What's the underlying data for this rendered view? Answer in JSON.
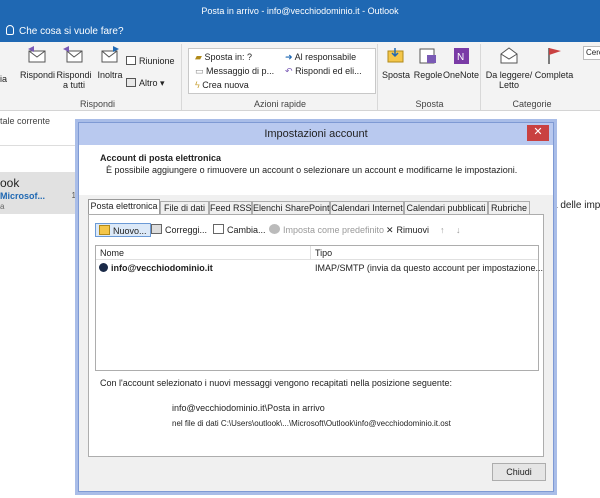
{
  "window": {
    "title": "Posta in arrivo - info@vecchiodominio.it - Outlook"
  },
  "tell_me": {
    "placeholder": "Che cosa si vuole fare?"
  },
  "ribbon": {
    "respond": {
      "label": "Rispondi",
      "reply": "Rispondi",
      "reply_all_line1": "Rispondi",
      "reply_all_line2": "a tutti",
      "forward": "Inoltra",
      "meeting": "Riunione",
      "more": "Altro",
      "left_cut": "ia"
    },
    "quick_steps": {
      "label": "Azioni rapide",
      "items": [
        "Sposta in: ?",
        "Messaggio di p...",
        "Crea nuova",
        "Al responsabile",
        "Rispondi ed eli..."
      ]
    },
    "move": {
      "label": "Sposta",
      "move": "Sposta",
      "rules": "Regole",
      "onenote": "OneNote"
    },
    "tags": {
      "label": "Categorie",
      "unread_line1": "Da leggere/",
      "unread_line2": "Letto",
      "complete": "Completa"
    },
    "search": {
      "placeholder": "Cerc"
    }
  },
  "left_pane": {
    "mailbox_scope": "tale corrente",
    "account_title": "ook",
    "account_sub": "Microsof...",
    "account_sub2": "a",
    "count": "1"
  },
  "right_snip": "a delle imp",
  "dialog": {
    "title": "Impostazioni account",
    "close_glyph": "✕",
    "heading": "Account di posta elettronica",
    "description": "È possibile aggiungere o rimuovere un account o selezionare un account e modificarne le impostazioni.",
    "tabs": [
      "Posta elettronica",
      "File di dati",
      "Feed RSS",
      "Elenchi SharePoint",
      "Calendari Internet",
      "Calendari pubblicati",
      "Rubriche"
    ],
    "toolbar": {
      "new": "Nuovo...",
      "repair": "Correggi...",
      "change": "Cambia...",
      "set_default": "Imposta come predefinito",
      "remove": "Rimuovi",
      "up": "↑",
      "down": "↓"
    },
    "columns": {
      "name": "Nome",
      "type": "Tipo"
    },
    "accounts": [
      {
        "name": "info@vecchiodominio.it",
        "type": "IMAP/SMTP (invia da questo account per impostazione..."
      }
    ],
    "delivery_text": "Con l'account selezionato i nuovi messaggi vengono recapitati nella posizione seguente:",
    "delivery_path": "info@vecchiodominio.it\\Posta in arrivo",
    "delivery_file": "nel file di dati C:\\Users\\outlook\\...\\Microsoft\\Outlook\\info@vecchiodominio.it.ost",
    "close_button": "Chiudi"
  },
  "colors": {
    "outlook_blue": "#1f68b3",
    "dialog_title": "#b9c9ef",
    "close_red": "#c94141"
  }
}
